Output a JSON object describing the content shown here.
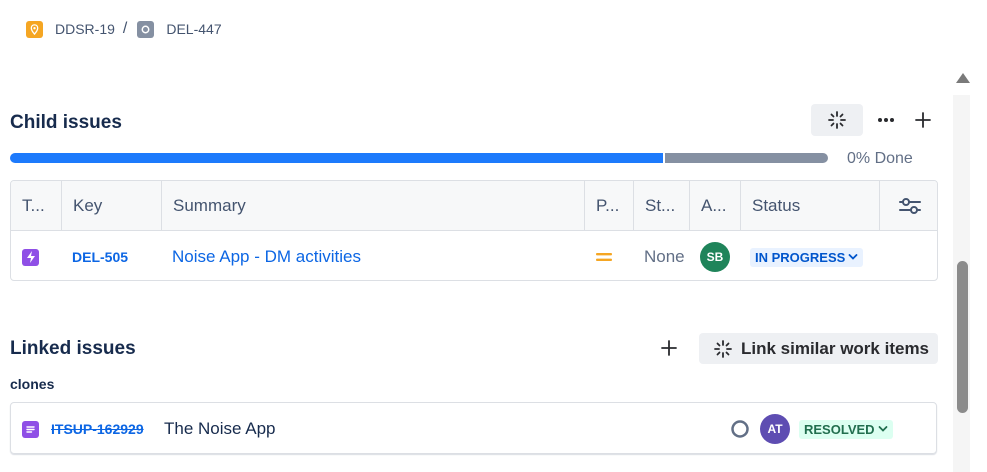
{
  "breadcrumb": {
    "items": [
      {
        "label": "DDSR-19",
        "icon": "location-pin-icon",
        "color": "#f5a623"
      },
      {
        "label": "DEL-447",
        "icon": "square-target-icon",
        "color": "#8590a2"
      }
    ],
    "separator": "/"
  },
  "child_issues": {
    "title": "Child issues",
    "progress": {
      "done_fraction": 0.8,
      "label": "0% Done"
    },
    "columns": [
      "T...",
      "Key",
      "Summary",
      "P...",
      "St...",
      "A...",
      "Status"
    ],
    "rows": [
      {
        "type_icon": "subtask-lightning-icon",
        "key": "DEL-505",
        "summary": "Noise App - DM activities",
        "priority_icon": "medium-priority-icon",
        "story_points": "None",
        "assignee": "SB",
        "assignee_color": "#1f845a",
        "status": "IN PROGRESS"
      }
    ]
  },
  "linked_issues": {
    "title": "Linked issues",
    "link_similar_label": "Link similar work items",
    "relation": "clones",
    "items": [
      {
        "type_icon": "task-document-icon",
        "key": "ITSUP-162929",
        "summary": "The Noise App",
        "assignee": "AT",
        "assignee_color": "#5e4db2",
        "status": "RESOLVED"
      }
    ]
  },
  "colors": {
    "accent": "#0c66e4",
    "progress_done": "#1d7afc",
    "progress_rest": "#8590a2"
  }
}
